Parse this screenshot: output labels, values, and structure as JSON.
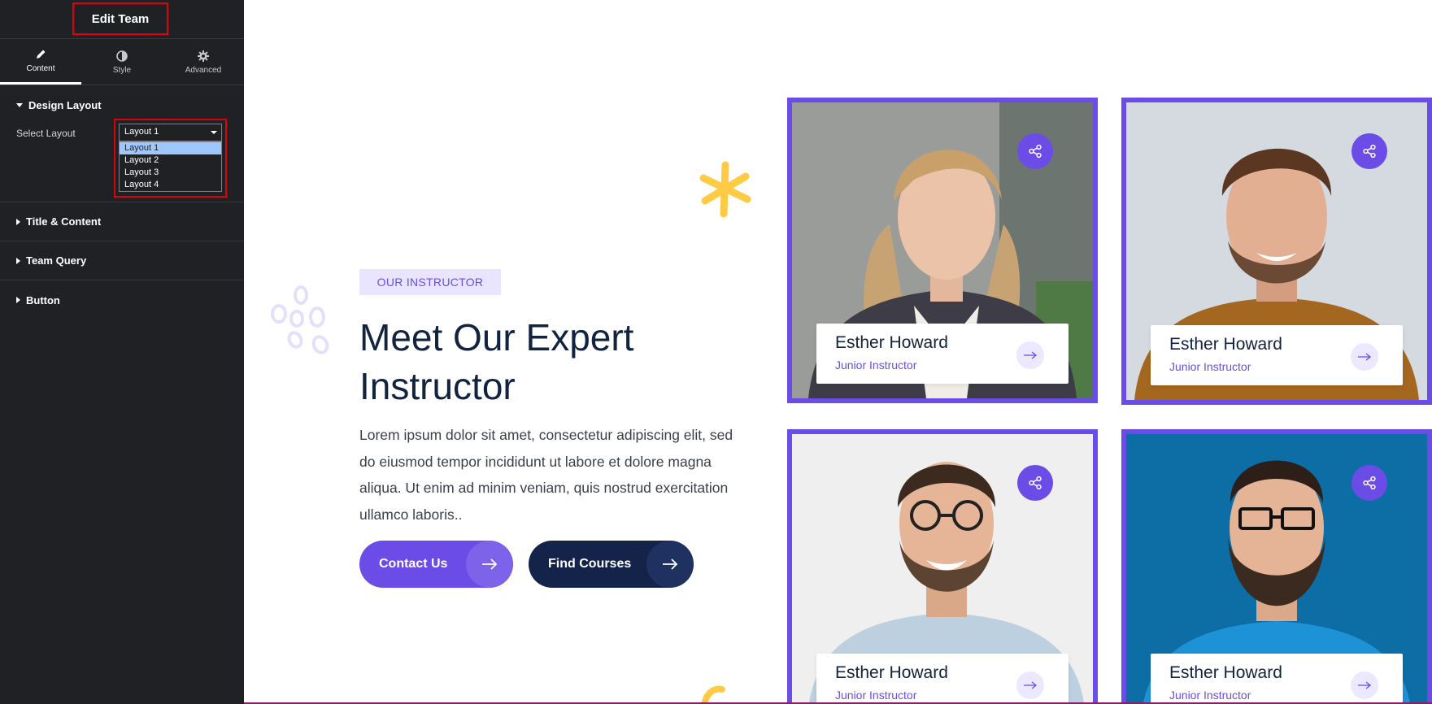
{
  "panel": {
    "title": "Edit Team",
    "tabs": [
      {
        "label": "Content",
        "icon": "pencil-icon"
      },
      {
        "label": "Style",
        "icon": "contrast-icon"
      },
      {
        "label": "Advanced",
        "icon": "gear-icon"
      }
    ],
    "design_layout": {
      "heading": "Design Layout",
      "select_label": "Select Layout",
      "selected": "Layout 1",
      "options": [
        "Layout 1",
        "Layout 2",
        "Layout 3",
        "Layout 4"
      ]
    },
    "sections": [
      "Title & Content",
      "Team Query",
      "Button"
    ]
  },
  "hero": {
    "badge": "OUR INSTRUCTOR",
    "headline_line1": "Meet Our Expert",
    "headline_line2": "Instructor",
    "paragraph": "Lorem ipsum dolor sit amet, consectetur adipiscing elit, sed do eiusmod tempor incididunt ut labore et dolore magna aliqua. Ut enim ad minim veniam, quis nostrud exercitation ullamco laboris..",
    "buttons": [
      {
        "label": "Contact Us"
      },
      {
        "label": "Find Courses"
      }
    ]
  },
  "team": [
    {
      "name": "Esther Howard",
      "role": "Junior Instructor"
    },
    {
      "name": "Esther Howard",
      "role": "Junior Instructor"
    },
    {
      "name": "Esther Howard",
      "role": "Junior Instructor"
    },
    {
      "name": "Esther Howard",
      "role": "Junior Instructor"
    }
  ],
  "colors": {
    "accent": "#6b4ce6",
    "navy": "#13234a",
    "panel_bg": "#1f2124",
    "highlight_red": "#e0000c",
    "star_yellow": "#ffcb45"
  }
}
